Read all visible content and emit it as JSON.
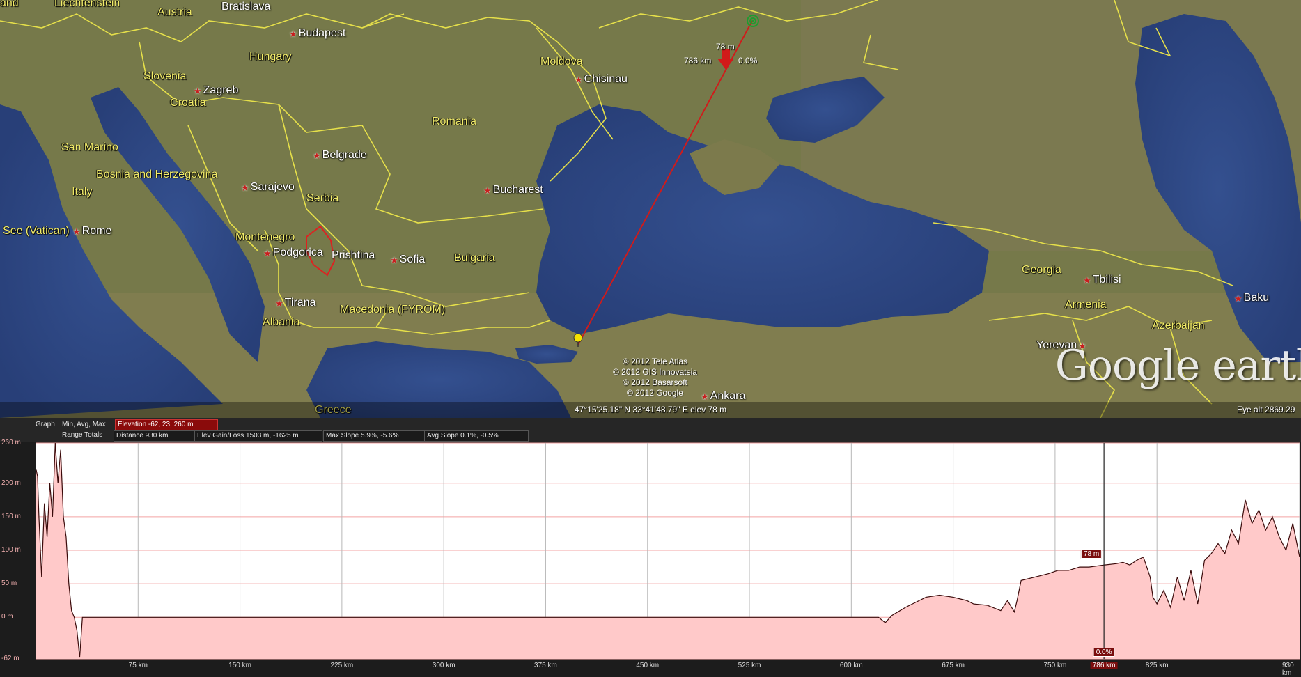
{
  "map": {
    "countries": [
      {
        "name": "Liechtenstein"
      },
      {
        "name": "Austria"
      },
      {
        "name": "Hungary"
      },
      {
        "name": "Slovenia"
      },
      {
        "name": "Croatia"
      },
      {
        "name": "San Marino"
      },
      {
        "name": "Bosnia and Herzegovina"
      },
      {
        "name": "Italy"
      },
      {
        "name": "Serbia"
      },
      {
        "name": "Montenegro"
      },
      {
        "name": "Romania"
      },
      {
        "name": "Moldova"
      },
      {
        "name": "Bulgaria"
      },
      {
        "name": "Macedonia (FYROM)"
      },
      {
        "name": "Albania"
      },
      {
        "name": "Greece"
      },
      {
        "name": "Georgia"
      },
      {
        "name": "Armenia"
      },
      {
        "name": "Azerbaijan"
      },
      {
        "name": "See (Vatican)"
      },
      {
        "name": "and"
      }
    ],
    "cities": [
      {
        "name": "Bratislava"
      },
      {
        "name": "Budapest"
      },
      {
        "name": "Zagreb"
      },
      {
        "name": "Chisinau"
      },
      {
        "name": "Belgrade"
      },
      {
        "name": "Sarajevo"
      },
      {
        "name": "Bucharest"
      },
      {
        "name": "Rome"
      },
      {
        "name": "Podgorica"
      },
      {
        "name": "Prishtina"
      },
      {
        "name": "Sofia"
      },
      {
        "name": "Tirana"
      },
      {
        "name": "Tbilisi"
      },
      {
        "name": "Baku"
      },
      {
        "name": "Yerevan"
      },
      {
        "name": "Ankara"
      }
    ],
    "marker_elevation": "78 m",
    "marker_distance": "786 km",
    "marker_slope": "0.0%",
    "copyright": [
      "© 2012 Tele Atlas",
      "© 2012 GIS Innovatsia",
      "© 2012 Basarsoft",
      "© 2012 Google"
    ],
    "coordinates": "47°15'25.18\" N  33°41'48.79\" E  elev   78 m",
    "eye_alt": "Eye alt  2869.29",
    "logo": "Google earth",
    "colors": {
      "border": "#e6e04a",
      "path": "#d11a1a",
      "water": "#2f4a8c"
    }
  },
  "profile": {
    "toolbar": {
      "graph": "Graph",
      "minavgmax": "Min, Avg, Max",
      "elevation": "Elevation  -62, 23, 260 m",
      "range_totals": "Range Totals",
      "distance": "Distance  930 km",
      "elev_gain": "Elev Gain/Loss  1503 m, -1625 m",
      "max_slope": "Max Slope  5.9%, -5.6%",
      "avg_slope": "Avg Slope  0.1%, -0.5%"
    },
    "cursor_elev_label": "78 m",
    "cursor_slope_label": "0.0%",
    "cursor_x_label": "786 km",
    "colors": {
      "fill": "#ffc9c9",
      "line": "#3a0a0a",
      "grid_h": "#f3a3a3",
      "grid_v": "#b8b8b8"
    }
  },
  "chart_data": {
    "type": "area",
    "title": "",
    "xlabel": "",
    "ylabel": "",
    "x_unit": "km",
    "y_unit": "m",
    "xlim": [
      0,
      930
    ],
    "ylim": [
      -62,
      260
    ],
    "x_ticks": [
      "75 km",
      "150 km",
      "225 km",
      "300 km",
      "375 km",
      "450 km",
      "525 km",
      "600 km",
      "675 km",
      "750 km",
      "786 km",
      "825 km",
      "930 km"
    ],
    "x_tick_values": [
      75,
      150,
      225,
      300,
      375,
      450,
      525,
      600,
      675,
      750,
      786,
      825,
      930
    ],
    "y_ticks": [
      "260 m",
      "200 m",
      "150 m",
      "100 m",
      "50 m",
      "0 m",
      "-62 m"
    ],
    "y_tick_values": [
      260,
      200,
      150,
      100,
      50,
      0,
      -62
    ],
    "cursor": {
      "x": 786,
      "y": 78
    },
    "series": [
      {
        "x": [
          0,
          1,
          2,
          4,
          6,
          8,
          10,
          12,
          14,
          16,
          18,
          20,
          22,
          24,
          26,
          28,
          30,
          32,
          34,
          36,
          40,
          50,
          100,
          200,
          300,
          400,
          500,
          600,
          620,
          625,
          630,
          640,
          650,
          655,
          665,
          675,
          685,
          690,
          700,
          710,
          715,
          720,
          722,
          725,
          735,
          745,
          752,
          760,
          768,
          775,
          786,
          795,
          800,
          805,
          810,
          815,
          820,
          822,
          825,
          830,
          835,
          840,
          845,
          850,
          855,
          860,
          865,
          870,
          875,
          880,
          885,
          890,
          895,
          900,
          905,
          910,
          915,
          920,
          925,
          930
        ],
        "y": [
          220,
          210,
          150,
          60,
          170,
          120,
          200,
          150,
          260,
          200,
          250,
          150,
          120,
          50,
          10,
          0,
          -20,
          -60,
          0,
          0,
          0,
          0,
          0,
          0,
          0,
          0,
          0,
          0,
          0,
          -8,
          3,
          15,
          25,
          30,
          33,
          30,
          25,
          20,
          18,
          10,
          25,
          8,
          25,
          55,
          60,
          65,
          70,
          70,
          75,
          75,
          78,
          80,
          82,
          78,
          85,
          90,
          60,
          30,
          20,
          40,
          15,
          60,
          25,
          70,
          20,
          85,
          95,
          110,
          95,
          130,
          110,
          175,
          140,
          160,
          130,
          150,
          120,
          100,
          140,
          90
        ]
      }
    ]
  }
}
